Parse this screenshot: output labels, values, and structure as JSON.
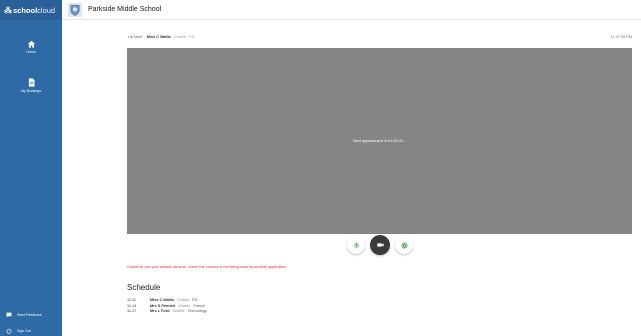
{
  "sidebar": {
    "brand_main": "school",
    "brand_sub": "cloud",
    "home_label": "Home",
    "bookings_label": "My Bookings",
    "feedback_label": "Send Feedback",
    "signout_label": "Sign Out"
  },
  "header": {
    "school_name": "Parkside Middle School"
  },
  "meeting": {
    "label": "Up Next:",
    "teacher": "Miss C Wallis",
    "role": "Charlie",
    "subject": "P.E.",
    "clock": "11:07:35 PM"
  },
  "video": {
    "message": "Next appointment in 01:30:00..."
  },
  "error_message": "Unable to use your default camera - check the camera is not being used by another application",
  "schedule": {
    "title": "Schedule",
    "rows": [
      {
        "time": "11:11",
        "name": "Miss C Wallis",
        "role": "Charlie",
        "subject": "P.E."
      },
      {
        "time": "11:14",
        "name": "Mrs S Penrich",
        "role": "Charlie",
        "subject": "French"
      },
      {
        "time": "11:17",
        "name": "Mrs L Ford",
        "role": "Charlie",
        "subject": "Technology"
      }
    ]
  },
  "colors": {
    "sidebar": "#2e6aa6",
    "video_bg": "#858585",
    "accent_green": "#4caf50",
    "error": "#e03030"
  },
  "icons": {
    "home": "home-icon",
    "bookings": "document-icon",
    "feedback": "feedback-icon",
    "signout": "power-icon",
    "mic": "microphone-icon",
    "camera": "camera-icon",
    "settings": "gear-icon"
  }
}
